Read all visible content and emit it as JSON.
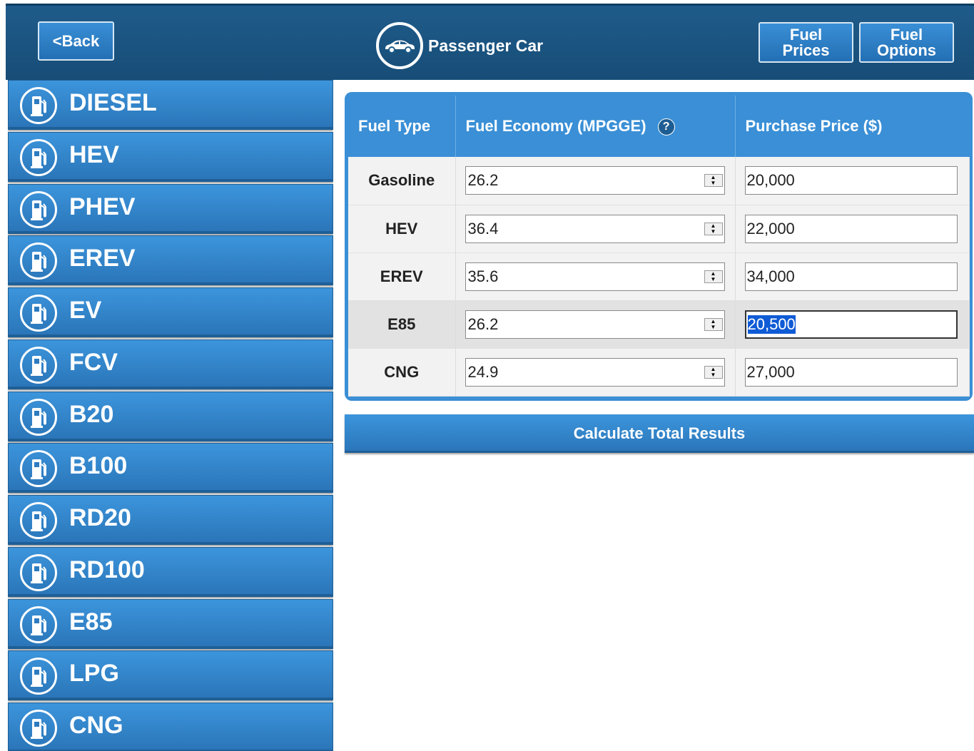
{
  "header": {
    "back_label": "<Back",
    "title": "Passenger Car",
    "vehicle_icon": "car-icon",
    "fuel_prices_line1": "Fuel",
    "fuel_prices_line2": "Prices",
    "fuel_options_line1": "Fuel",
    "fuel_options_line2": "Options"
  },
  "sidebar": {
    "item_icon": "fuel-pump-icon",
    "items": [
      {
        "label": "DIESEL"
      },
      {
        "label": "HEV"
      },
      {
        "label": "PHEV"
      },
      {
        "label": "EREV"
      },
      {
        "label": "EV"
      },
      {
        "label": "FCV"
      },
      {
        "label": "B20"
      },
      {
        "label": "B100"
      },
      {
        "label": "RD20"
      },
      {
        "label": "RD100"
      },
      {
        "label": "E85"
      },
      {
        "label": "LPG"
      },
      {
        "label": "CNG"
      }
    ]
  },
  "table": {
    "headers": {
      "fuel_type": "Fuel Type",
      "fuel_economy": "Fuel Economy (MPGGE)",
      "help": "?",
      "purchase_price": "Purchase Price ($)"
    },
    "rows": [
      {
        "type": "Gasoline",
        "economy": "26.2",
        "price": "20,000"
      },
      {
        "type": "HEV",
        "economy": "36.4",
        "price": "22,000"
      },
      {
        "type": "EREV",
        "economy": "35.6",
        "price": "34,000"
      },
      {
        "type": "E85",
        "economy": "26.2",
        "price": "20,500"
      },
      {
        "type": "CNG",
        "economy": "24.9",
        "price": "27,000"
      }
    ],
    "focused_row": 3
  },
  "calculate_label": "Calculate Total Results",
  "colors": {
    "header_bg": "#1f5b8a",
    "button_blue": "#3a8fd6",
    "selection": "#0f5bd6"
  }
}
